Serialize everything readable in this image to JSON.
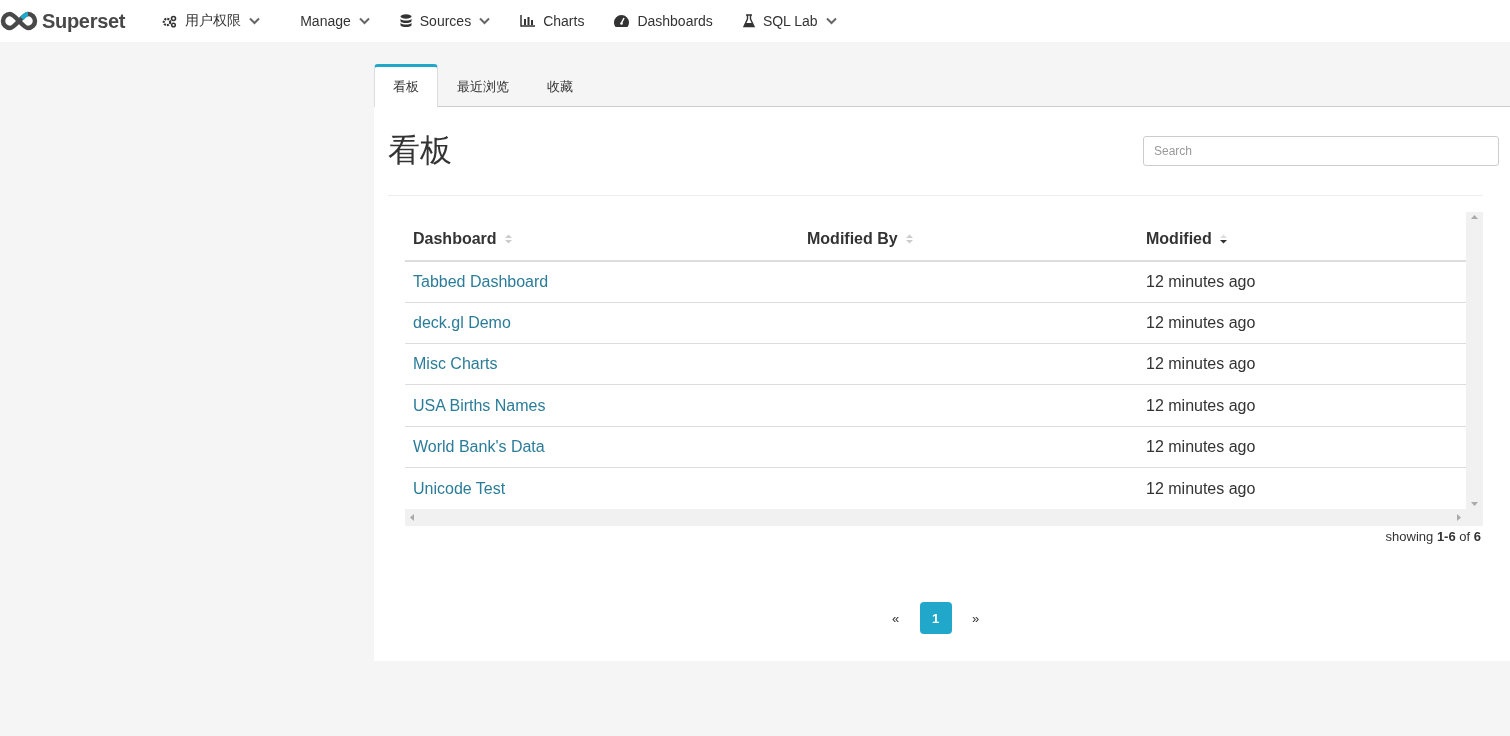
{
  "navbar": {
    "brand": "Superset",
    "items": [
      {
        "label": "用户权限",
        "dropdown": true
      },
      {
        "label": "Manage",
        "dropdown": true
      },
      {
        "label": "Sources",
        "dropdown": true
      },
      {
        "label": "Charts",
        "dropdown": false
      },
      {
        "label": "Dashboards",
        "dropdown": false
      },
      {
        "label": "SQL Lab",
        "dropdown": true
      }
    ]
  },
  "tabs": [
    {
      "label": "看板",
      "selected": true
    },
    {
      "label": "最近浏览",
      "selected": false
    },
    {
      "label": "收藏",
      "selected": false
    }
  ],
  "page_title": "看板",
  "search": {
    "placeholder": "Search"
  },
  "table": {
    "columns": [
      {
        "label": "Dashboard",
        "sorted": false
      },
      {
        "label": "Modified By",
        "sorted": false
      },
      {
        "label": "Modified",
        "sorted": true
      }
    ],
    "rows": [
      {
        "dashboard": "Tabbed Dashboard",
        "modified": "12 minutes ago"
      },
      {
        "dashboard": "deck.gl Demo",
        "modified": "12 minutes ago"
      },
      {
        "dashboard": "Misc Charts",
        "modified": "12 minutes ago"
      },
      {
        "dashboard": "USA Births Names",
        "modified": "12 minutes ago"
      },
      {
        "dashboard": "World Bank's Data",
        "modified": "12 minutes ago"
      },
      {
        "dashboard": "Unicode Test",
        "modified": "12 minutes ago"
      }
    ]
  },
  "showing": "showing **1-6** of **6**",
  "pagination": [
    {
      "label": "«",
      "selected": false
    },
    {
      "label": "1",
      "selected": true
    },
    {
      "label": "»",
      "selected": false
    }
  ]
}
